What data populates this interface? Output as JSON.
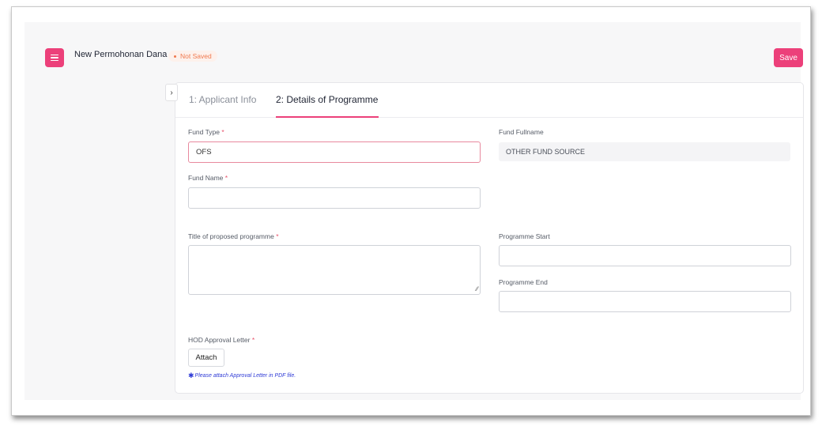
{
  "header": {
    "title": "New Permohonan Dana",
    "status": "Not Saved",
    "save_label": "Save",
    "menu_icon": "hamburger-icon",
    "toggle_icon": "chevron-right-icon",
    "toggle_glyph": "›"
  },
  "tabs": [
    {
      "label": "1: Applicant Info",
      "active": false
    },
    {
      "label": "2: Details of Programme",
      "active": true
    }
  ],
  "form": {
    "fund_type": {
      "label": "Fund Type",
      "required_mark": "*",
      "value": "OFS"
    },
    "fund_fullname": {
      "label": "Fund Fullname",
      "value": "OTHER FUND SOURCE"
    },
    "fund_name": {
      "label": "Fund Name",
      "required_mark": "*",
      "value": ""
    },
    "title": {
      "label": "Title of proposed programme",
      "required_mark": "*",
      "value": ""
    },
    "programme_start": {
      "label": "Programme Start",
      "value": ""
    },
    "programme_end": {
      "label": "Programme End",
      "value": ""
    },
    "hod_letter": {
      "label": "HOD Approval Letter",
      "required_mark": "*",
      "attach_label": "Attach",
      "hint_icon": "asterisk-icon",
      "hint_glyph": "✱",
      "hint": "Please attach Approval Letter in PDF file."
    }
  },
  "colors": {
    "accent": "#ec407a",
    "status_text": "#f0794e",
    "hint_text": "#2f3bd6"
  }
}
